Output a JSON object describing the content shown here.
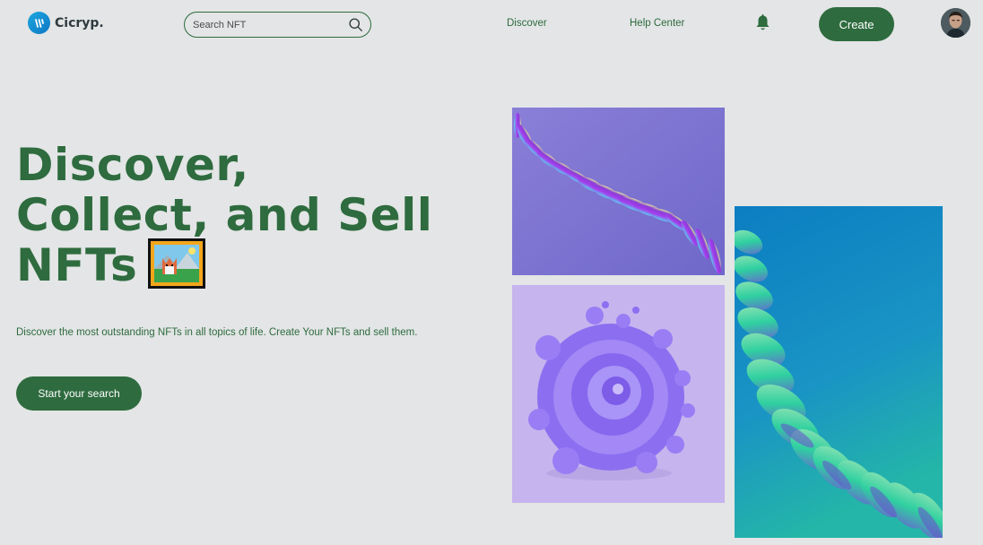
{
  "header": {
    "brand": "Cicryp.",
    "search_placeholder": "Search NFT",
    "nav": [
      "Discover",
      "Help Center"
    ],
    "create_label": "Create"
  },
  "hero": {
    "title_lines": [
      "Discover,",
      "Collect, and Sell",
      "NFTs"
    ],
    "subtitle": "Discover the most outstanding NFTs in all topics of life. Create Your NFTs and sell them.",
    "cta_label": "Start your search"
  },
  "colors": {
    "primary": "#2e6b3e",
    "background": "#e3e5e6"
  },
  "icons": [
    "logo-icon",
    "search-icon",
    "bell-icon",
    "nft-frame-icon"
  ]
}
